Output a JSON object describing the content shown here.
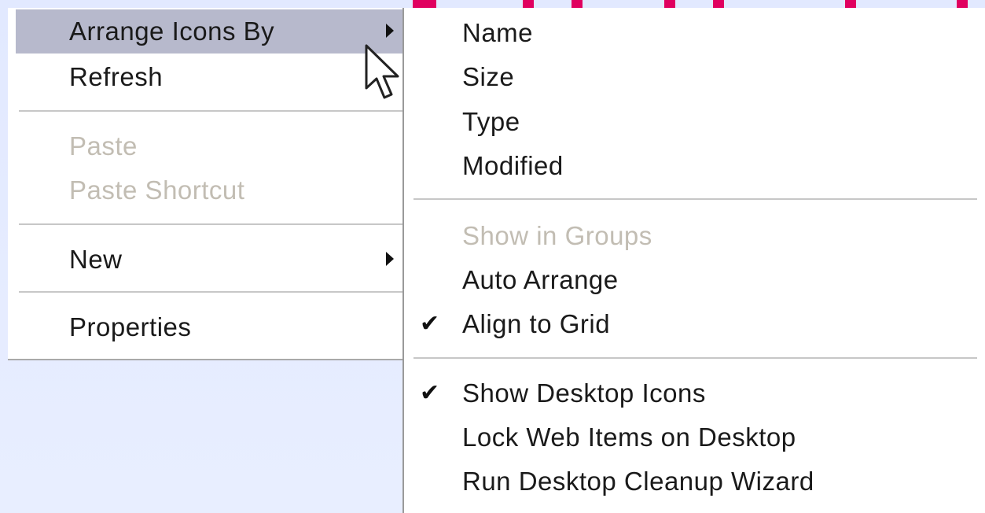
{
  "main_menu": {
    "items": [
      {
        "label": "Arrange Icons By",
        "has_submenu": true,
        "highlighted": true
      },
      {
        "label": "Refresh"
      },
      {
        "label": "Paste",
        "disabled": true
      },
      {
        "label": "Paste Shortcut",
        "disabled": true
      },
      {
        "label": "New",
        "has_submenu": true
      },
      {
        "label": "Properties"
      }
    ]
  },
  "submenu": {
    "items": [
      {
        "label": "Name"
      },
      {
        "label": "Size"
      },
      {
        "label": "Type"
      },
      {
        "label": "Modified"
      },
      {
        "label": "Show in Groups",
        "disabled": true
      },
      {
        "label": "Auto Arrange"
      },
      {
        "label": "Align to Grid",
        "checked": true
      },
      {
        "label": "Show Desktop Icons",
        "checked": true
      },
      {
        "label": "Lock Web Items on Desktop"
      },
      {
        "label": "Run Desktop Cleanup Wizard"
      }
    ],
    "check_glyph": "✔"
  },
  "colors": {
    "highlight": "#b7b9cc",
    "disabled_text": "#c2bdb3",
    "desktop_bg": "#e6ecff",
    "selection_marks": "#e0005f"
  }
}
